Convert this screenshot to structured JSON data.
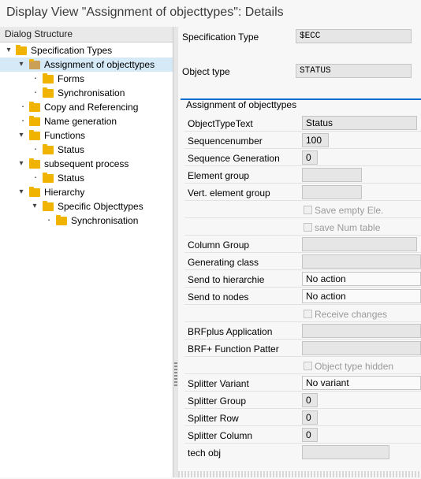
{
  "title": "Display View \"Assignment of objecttypes\": Details",
  "dialog_structure": {
    "header": "Dialog Structure",
    "items": [
      {
        "label": "Specification Types",
        "toggle": "▾"
      },
      {
        "label": "Assignment of objecttypes",
        "toggle": "▾"
      },
      {
        "label": "Forms",
        "toggle": "▪"
      },
      {
        "label": "Synchronisation",
        "toggle": "▪"
      },
      {
        "label": "Copy and Referencing",
        "toggle": "▪"
      },
      {
        "label": "Name generation",
        "toggle": "▪"
      },
      {
        "label": "Functions",
        "toggle": "▾"
      },
      {
        "label": "Status",
        "toggle": "▪"
      },
      {
        "label": "subsequent process",
        "toggle": "▾"
      },
      {
        "label": "Status",
        "toggle": "▪"
      },
      {
        "label": "Hierarchy",
        "toggle": "▾"
      },
      {
        "label": "Specific Objecttypes",
        "toggle": "▾"
      },
      {
        "label": "Synchronisation",
        "toggle": "▪"
      }
    ]
  },
  "header_fields": {
    "spec_type_label": "Specification Type",
    "spec_type_value": "$ECC",
    "object_type_label": "Object type",
    "object_type_value": "STATUS"
  },
  "group": {
    "title": "Assignment of objecttypes",
    "object_type_text_label": "ObjectTypeText",
    "object_type_text_value": "Status",
    "sequence_number_label": "Sequencenumber",
    "sequence_number_value": "100",
    "sequence_generation_label": "Sequence Generation",
    "sequence_generation_value": "0",
    "element_group_label": "Element group",
    "element_group_value": "",
    "vert_element_group_label": "Vert. element group",
    "vert_element_group_value": "",
    "save_empty_label": "Save empty Ele.",
    "save_num_label": "save Num table",
    "column_group_label": "Column Group",
    "column_group_value": "",
    "generating_class_label": "Generating class",
    "generating_class_value": "",
    "send_to_hierarchie_label": "Send to hierarchie",
    "send_to_hierarchie_value": "No action",
    "send_to_nodes_label": "Send to nodes",
    "send_to_nodes_value": "No action",
    "receive_changes_label": "Receive changes",
    "brfplus_app_label": "BRFplus Application",
    "brfplus_app_value": "",
    "brf_function_label": "BRF+ Function Patter",
    "brf_function_value": "",
    "object_type_hidden_label": "Object type hidden",
    "splitter_variant_label": "Splitter Variant",
    "splitter_variant_value": "No variant",
    "splitter_group_label": "Splitter Group",
    "splitter_group_value": "0",
    "splitter_row_label": "Splitter Row",
    "splitter_row_value": "0",
    "splitter_column_label": "Splitter Column",
    "splitter_column_value": "0",
    "tech_obj_label": "tech obj",
    "tech_obj_value": ""
  }
}
